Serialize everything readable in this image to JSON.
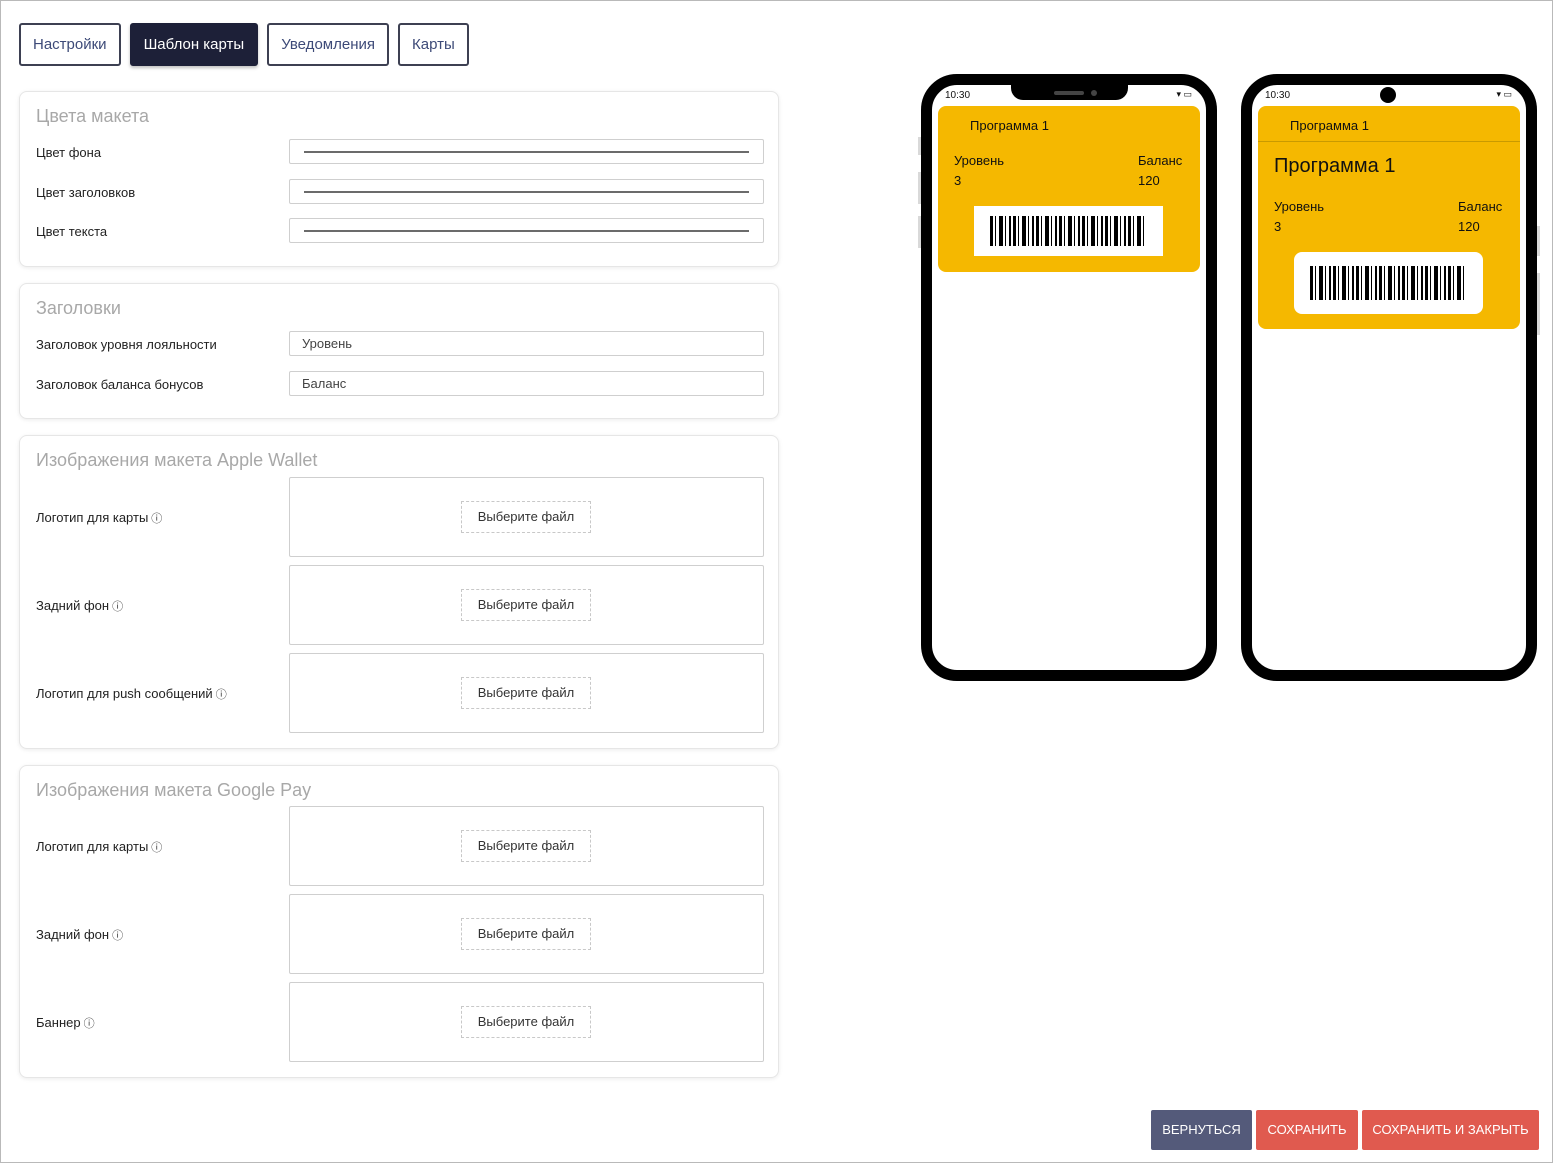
{
  "tabs": [
    {
      "label": "Настройки"
    },
    {
      "label": "Шаблон карты"
    },
    {
      "label": "Уведомления"
    },
    {
      "label": "Карты"
    }
  ],
  "colors_section": {
    "title": "Цвета макета",
    "rows": [
      {
        "label": "Цвет фона"
      },
      {
        "label": "Цвет заголовков"
      },
      {
        "label": "Цвет текста"
      }
    ]
  },
  "headers_section": {
    "title": "Заголовки",
    "rows": [
      {
        "label": "Заголовок уровня лояльности",
        "value": "Уровень"
      },
      {
        "label": "Заголовок баланса бонусов",
        "value": "Баланс"
      }
    ]
  },
  "apple_section": {
    "title": "Изображения макета Apple Wallet",
    "rows": [
      {
        "label": "Логотип для карты",
        "button": "Выберите файл"
      },
      {
        "label": "Задний фон",
        "button": "Выберите файл"
      },
      {
        "label": "Логотип для push сообщений",
        "button": "Выберите файл"
      }
    ]
  },
  "google_section": {
    "title": "Изображения макета Google Pay",
    "rows": [
      {
        "label": "Логотип для карты",
        "button": "Выберите файл"
      },
      {
        "label": "Задний фон",
        "button": "Выберите файл"
      },
      {
        "label": "Баннер",
        "button": "Выберите файл"
      }
    ]
  },
  "info_glyph": "ⓘ",
  "preview_apple": {
    "time": "10:30",
    "status_icons": "▾ ▭",
    "program": "Программа 1",
    "level_label": "Уровень",
    "level_value": "3",
    "balance_label": "Баланс",
    "balance_value": "120"
  },
  "preview_google": {
    "time": "10:30",
    "status_icons": "▾ ▭",
    "program_small": "Программа 1",
    "program_big": "Программа 1",
    "level_label": "Уровень",
    "level_value": "3",
    "balance_label": "Баланс",
    "balance_value": "120"
  },
  "card_color": "#f5b800",
  "buttons": {
    "back": "ВЕРНУТЬСЯ",
    "save": "СОХРАНИТЬ",
    "save_close": "СОХРАНИТЬ И ЗАКРЫТЬ"
  },
  "button_colors": {
    "back": "#545a7a",
    "save": "#e05a4f"
  }
}
